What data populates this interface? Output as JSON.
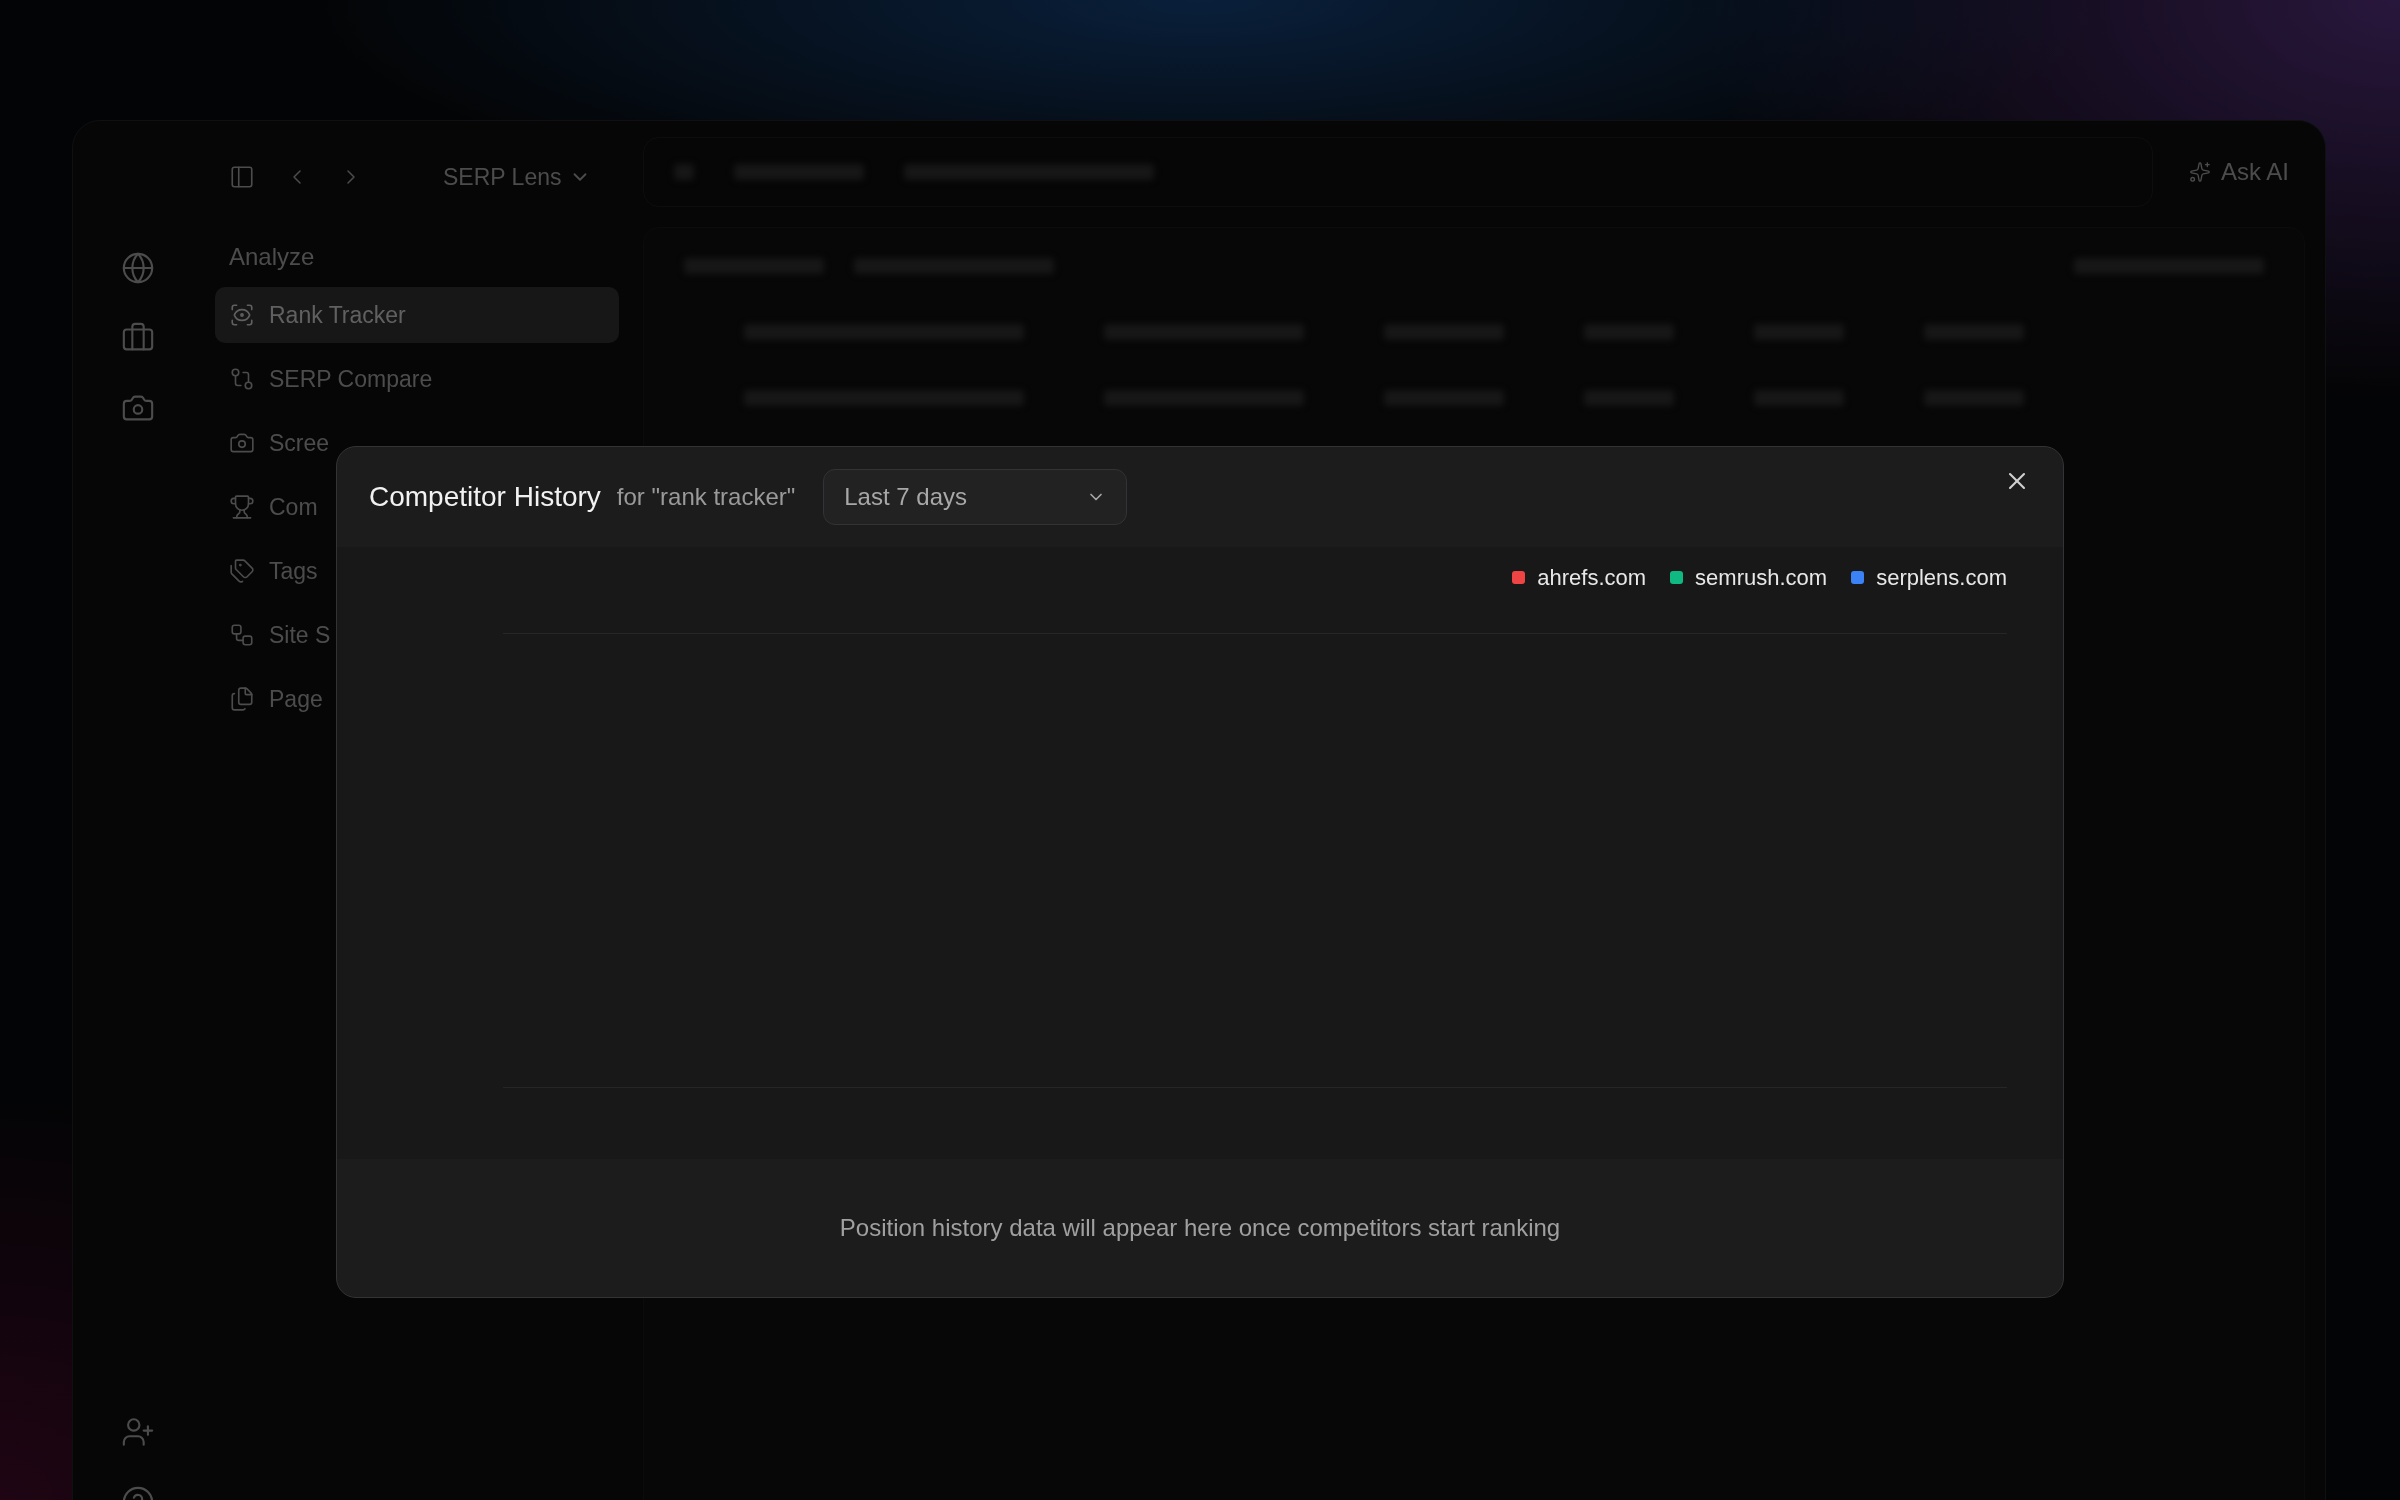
{
  "app": {
    "workspace": "SERP Lens",
    "ask_ai": "Ask AI"
  },
  "sidebar": {
    "section": "Analyze",
    "items": [
      {
        "label": "Rank Tracker",
        "selected": true
      },
      {
        "label": "SERP Compare",
        "selected": false
      },
      {
        "label": "Scree",
        "selected": false
      },
      {
        "label": "Com",
        "selected": false
      },
      {
        "label": "Tags",
        "selected": false
      },
      {
        "label": "Site S",
        "selected": false
      },
      {
        "label": "Page",
        "selected": false
      }
    ]
  },
  "modal": {
    "title": "Competitor History",
    "subtitle": "for \"rank tracker\"",
    "range": "Last 7 days",
    "legend": [
      {
        "label": "ahrefs.com",
        "color": "#ef4444"
      },
      {
        "label": "semrush.com",
        "color": "#10b981"
      },
      {
        "label": "serplens.com",
        "color": "#3b82f6"
      }
    ],
    "empty_message": "Position history data will appear here once competitors start ranking"
  }
}
